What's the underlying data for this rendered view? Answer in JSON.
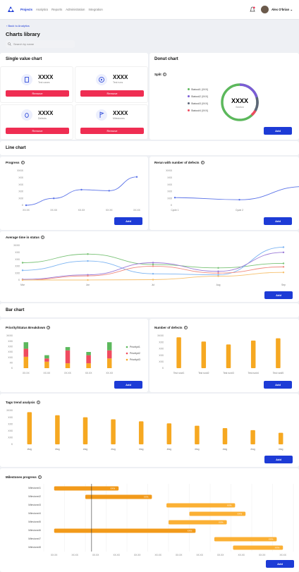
{
  "nav": {
    "items": [
      "Projects",
      "Analytics",
      "Reports",
      "Administration",
      "Integration"
    ],
    "user": "Alex O'brian"
  },
  "page": {
    "back": "Back to Analytics",
    "title": "Charts library",
    "search_placeholder": "Search by name"
  },
  "single_value": {
    "title": "Single value chart",
    "tiles": [
      {
        "value": "XXXX",
        "label": "Test cases",
        "icon": "document-icon",
        "button": "Remove"
      },
      {
        "value": "XXXX",
        "label": "Test runs",
        "icon": "play-icon",
        "button": "Remove"
      },
      {
        "value": "XXXX",
        "label": "Defects",
        "icon": "bug-icon",
        "button": "Remove"
      },
      {
        "value": "XXXX",
        "label": "Milestones",
        "icon": "flag-icon",
        "button": "Remove"
      }
    ]
  },
  "donut": {
    "section_title": "Donut chart",
    "title": "Split",
    "center_value": "XXXX",
    "center_label": "Section",
    "add": "Add",
    "legend": [
      {
        "label": "Status#1 (XXX)",
        "color": "#5cb85c"
      },
      {
        "label": "Status#2 (XXX)",
        "color": "#7b5cd6"
      },
      {
        "label": "Status#3 (XXX)",
        "color": "#5d6678"
      },
      {
        "label": "Status#4 (XXX)",
        "color": "#ef4b5f"
      }
    ]
  },
  "line_section": "Line chart",
  "progress": {
    "title": "Progress",
    "add": "Add"
  },
  "rerun": {
    "title": "Rerun with number of defects",
    "add": "Add"
  },
  "avg": {
    "title": "Average time in status",
    "add": "Add"
  },
  "bar_section": "Bar chart",
  "priority": {
    "title": "Priority/Status Breakdown",
    "add": "Add"
  },
  "defects": {
    "title": "Number of defects",
    "add": "Add"
  },
  "tags": {
    "title": "Tags trend analysis",
    "add": "Add"
  },
  "milestones": {
    "title": "Milestones progress",
    "add": "Add"
  },
  "chart_data": [
    {
      "id": "progress",
      "type": "line",
      "yticks": [
        "XXXX",
        "XXX",
        "XXX",
        "XXX",
        "XXX",
        "X"
      ],
      "categories": [
        "XX.XX",
        "XX.XX",
        "XX.XX",
        "XX.XX",
        "XX.XX"
      ],
      "series": [
        {
          "color": "#5b73e8",
          "values": [
            0,
            2,
            4.5,
            4.2,
            8.2
          ]
        }
      ],
      "ylim": [
        0,
        10
      ]
    },
    {
      "id": "rerun",
      "type": "line",
      "yticks": [
        "XXXX",
        "XXX",
        "XXX",
        "XXX",
        "XXX",
        "X"
      ],
      "categories": [
        "Cycle 1",
        "Cycle 2",
        "Cycle 3",
        "Cycle 4",
        "Cycle 5"
      ],
      "series": [
        {
          "color": "#5b73e8",
          "values": [
            2.2,
            1.6,
            5.4,
            2.1,
            0.6
          ]
        }
      ],
      "ylim": [
        0,
        10
      ]
    },
    {
      "id": "avg",
      "type": "line",
      "yticks": [
        "XXXX",
        "XXX",
        "XXX",
        "XXX",
        "XXX",
        "X"
      ],
      "categories": [
        "Mar",
        "Jun",
        "Jul",
        "Aug",
        "Sep"
      ],
      "series": [
        {
          "color": "#79c276",
          "values": [
            5,
            7.5,
            4.5,
            3.5,
            4.8
          ]
        },
        {
          "color": "#7cb4f2",
          "values": [
            2.8,
            5.5,
            1.8,
            1.5,
            9.5
          ]
        },
        {
          "color": "#9a79d6",
          "values": [
            0.2,
            1.5,
            5,
            2.5,
            8
          ]
        },
        {
          "color": "#f08b80",
          "values": [
            0,
            1.2,
            4,
            2,
            3.8
          ]
        },
        {
          "color": "#f6c06d",
          "values": [
            0,
            0,
            0.1,
            1.1,
            2.2
          ]
        }
      ],
      "ylim": [
        0,
        10
      ]
    },
    {
      "id": "priority",
      "type": "bar",
      "stacked": true,
      "yticks": [
        "XXXX",
        "XXX",
        "XXX",
        "XXX",
        "XXX",
        "XX",
        "X"
      ],
      "categories": [
        "XX.XX",
        "XX.XX",
        "XX.XX",
        "XX.XX",
        "XX.XX"
      ],
      "series": [
        {
          "name": "Priority#1",
          "color": "#5cb85c",
          "values": [
            2,
            1,
            1,
            1,
            2.5
          ]
        },
        {
          "name": "Priority#2",
          "color": "#ef4b5f",
          "values": [
            2.5,
            1,
            4,
            2.5,
            2.5
          ]
        },
        {
          "name": "Priority#3",
          "color": "#f6a821",
          "values": [
            3.5,
            2,
            1.5,
            1.5,
            3
          ]
        }
      ],
      "ylim": [
        0,
        10
      ]
    },
    {
      "id": "defects",
      "type": "bar",
      "yticks": [
        "XXXX",
        "XXX",
        "XXX",
        "XXX",
        "XXX",
        "X"
      ],
      "categories": [
        "Test run#1",
        "Test run#2",
        "Test run#3",
        "Test run#4",
        "Test run#5"
      ],
      "values": [
        9.5,
        8.2,
        7.3,
        8.5,
        9.2
      ],
      "color": "#f6a821",
      "ylim": [
        0,
        10
      ]
    },
    {
      "id": "tags",
      "type": "bar",
      "yticks": [
        "XXXX",
        "XXX",
        "XXX",
        "XXX",
        "XXX",
        "X"
      ],
      "categories": [
        "#tag",
        "#tag",
        "#tag",
        "#tag",
        "#tag",
        "#tag",
        "#tag",
        "#tag",
        "#tag",
        "#tag"
      ],
      "values": [
        9.5,
        8.6,
        8,
        7.4,
        6.8,
        6.2,
        5.5,
        4.8,
        4.2,
        3.4
      ],
      "color": "#f6a821",
      "ylim": [
        0,
        10
      ]
    },
    {
      "id": "milestones",
      "type": "gantt",
      "xticks": [
        "XX.XX",
        "XX.XX",
        "XX.XX",
        "XX.XX",
        "XX.XX",
        "XX.XX",
        "XX.XX",
        "XX.XX",
        "XX.XX",
        "XX.XX",
        "XX.XX",
        "XX.XX"
      ],
      "marker": 2.3,
      "rows": [
        {
          "name": "Milestone#1",
          "start": 0.5,
          "end": 3.6,
          "label": "XX%",
          "dark": true
        },
        {
          "name": "Milestone#2",
          "start": 2,
          "end": 5.2,
          "label": "XX%",
          "dark": true
        },
        {
          "name": "Milestone#3",
          "start": 5.9,
          "end": 9.2,
          "label": "XX%"
        },
        {
          "name": "Milestone#4",
          "start": 7,
          "end": 9.7,
          "label": "XX%"
        },
        {
          "name": "Milestone#5",
          "start": 6,
          "end": 8.8,
          "label": "XX%"
        },
        {
          "name": "Milestone#6",
          "start": 0.5,
          "end": 7.3,
          "label": "XX%",
          "dark": true
        },
        {
          "name": "Milestone#7",
          "start": 8.2,
          "end": 11.2,
          "label": "XX%"
        },
        {
          "name": "Milestone#8",
          "start": 9.1,
          "end": 11.5,
          "label": "XX%"
        }
      ]
    }
  ]
}
